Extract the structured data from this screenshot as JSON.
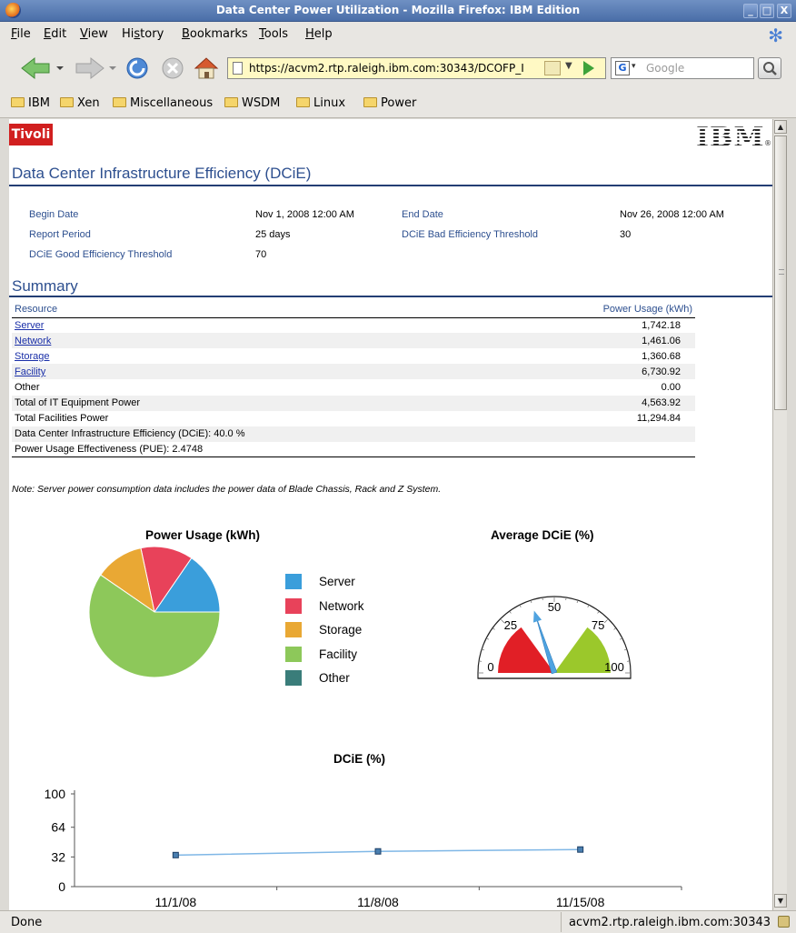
{
  "window": {
    "title": "Data Center Power Utilization - Mozilla Firefox: IBM Edition",
    "buttons": [
      "_",
      "□",
      "X"
    ]
  },
  "menu": [
    {
      "u": "F",
      "rest": "ile"
    },
    {
      "u": "E",
      "rest": "dit"
    },
    {
      "u": "V",
      "rest": "iew"
    },
    {
      "pre": "Hi",
      "u": "s",
      "rest": "tory"
    },
    {
      "u": "B",
      "rest": "ookmarks"
    },
    {
      "u": "T",
      "rest": "ools"
    },
    {
      "u": "H",
      "rest": "elp"
    }
  ],
  "nav": {
    "url": "https://acvm2.rtp.raleigh.ibm.com:30343/DCOFP_I",
    "search_placeholder": "Google",
    "search_engine": "G"
  },
  "bookmarks": [
    "IBM",
    "Xen",
    "Miscellaneous",
    "WSDM",
    "Linux",
    "Power"
  ],
  "page": {
    "brand_left": "Tivoli",
    "brand_right": "IBM",
    "heading": "Data Center Infrastructure Efficiency (DCiE)",
    "params": {
      "begin_label": "Begin Date",
      "begin_value": "Nov 1, 2008 12:00 AM",
      "end_label": "End Date",
      "end_value": "Nov 26, 2008 12:00 AM",
      "period_label": "Report Period",
      "period_value": "25 days",
      "bad_label": "DCiE Bad Efficiency Threshold",
      "bad_value": "30",
      "good_label": "DCiE Good Efficiency Threshold",
      "good_value": "70"
    },
    "summary_heading": "Summary",
    "table": {
      "col_resource": "Resource",
      "col_power": "Power Usage (kWh)",
      "rows": [
        {
          "name": "Server",
          "value": "1,742.18",
          "link": true
        },
        {
          "name": "Network",
          "value": "1,461.06",
          "link": true
        },
        {
          "name": "Storage",
          "value": "1,360.68",
          "link": true
        },
        {
          "name": "Facility",
          "value": "6,730.92",
          "link": true
        },
        {
          "name": "Other",
          "value": "0.00",
          "link": false
        },
        {
          "name": "Total of IT Equipment Power",
          "value": "4,563.92",
          "link": false
        },
        {
          "name": "Total Facilities Power",
          "value": "11,294.84",
          "link": false
        },
        {
          "name": "Data Center Infrastructure Efficiency (DCiE): 40.0 %",
          "value": "",
          "link": false
        },
        {
          "name": "Power Usage Effectiveness (PUE): 2.4748",
          "value": "",
          "link": false
        }
      ]
    },
    "note": "Note: Server power consumption data includes the power data of Blade Chassis, Rack and Z System."
  },
  "chart_data": [
    {
      "type": "pie",
      "title": "Power Usage (kWh)",
      "categories": [
        "Server",
        "Network",
        "Storage",
        "Facility",
        "Other"
      ],
      "values": [
        1742.18,
        1461.06,
        1360.68,
        6730.92,
        0.0
      ],
      "colors": [
        "#3a9edb",
        "#e8425a",
        "#e9a834",
        "#8dc85a",
        "#3a7d7a"
      ],
      "legend": "right"
    },
    {
      "type": "gauge",
      "title": "Average DCiE (%)",
      "value": 40.0,
      "range": [
        0,
        100
      ],
      "tick_labels": [
        "0",
        "25",
        "50",
        "75",
        "100"
      ],
      "bad_zone": [
        0,
        30
      ],
      "good_zone": [
        70,
        100
      ],
      "colors": {
        "bad": "#e11f26",
        "good": "#9bc82b",
        "needle": "#4fa3e0"
      }
    },
    {
      "type": "line",
      "title": "DCiE (%)",
      "x": [
        "11/1/08",
        "11/8/08",
        "11/15/08"
      ],
      "series": [
        {
          "values": [
            34,
            38,
            40
          ]
        }
      ],
      "ylim": [
        0,
        100
      ],
      "yticks": [
        "0",
        "32",
        "64",
        "100"
      ],
      "color": "#7fb7e6"
    }
  ],
  "status": {
    "left": "Done",
    "right": "acvm2.rtp.raleigh.ibm.com:30343"
  }
}
